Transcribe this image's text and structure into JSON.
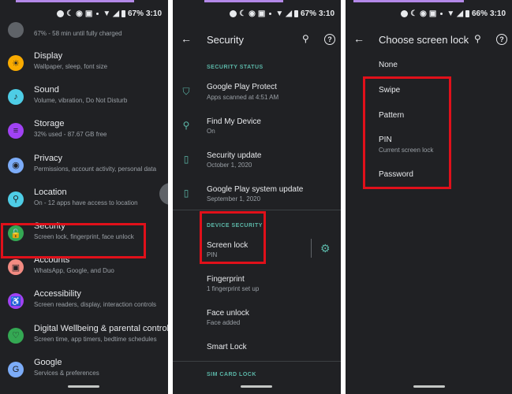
{
  "status": {
    "battery": "67%",
    "time": "3:10",
    "battery_p3": "66%",
    "network": "4G"
  },
  "settings_list": {
    "partial_top_sub": "67% - 58 min until fully charged",
    "items": [
      {
        "title": "Display",
        "subtitle": "Wallpaper, sleep, font size",
        "icon": "display-icon",
        "color": "#f9ab00"
      },
      {
        "title": "Sound",
        "subtitle": "Volume, vibration, Do Not Disturb",
        "icon": "sound-icon",
        "color": "#4ecde6"
      },
      {
        "title": "Storage",
        "subtitle": "32% used - 87.67 GB free",
        "icon": "storage-icon",
        "color": "#a142f4"
      },
      {
        "title": "Privacy",
        "subtitle": "Permissions, account activity, personal data",
        "icon": "privacy-icon",
        "color": "#7cacf8"
      },
      {
        "title": "Location",
        "subtitle": "On - 12 apps have access to location",
        "icon": "location-icon",
        "color": "#4ecde6"
      },
      {
        "title": "Security",
        "subtitle": "Screen lock, fingerprint, face unlock",
        "icon": "security-icon",
        "color": "#34a853"
      },
      {
        "title": "Accounts",
        "subtitle": "WhatsApp, Google, and Duo",
        "icon": "accounts-icon",
        "color": "#f28b82"
      },
      {
        "title": "Accessibility",
        "subtitle": "Screen readers, display, interaction controls",
        "icon": "accessibility-icon",
        "color": "#a142f4"
      },
      {
        "title": "Digital Wellbeing & parental controls",
        "subtitle": "Screen time, app timers, bedtime schedules",
        "icon": "wellbeing-icon",
        "color": "#34a853"
      },
      {
        "title": "Google",
        "subtitle": "Services & preferences",
        "icon": "google-icon",
        "color": "#7cacf8"
      }
    ]
  },
  "security_page": {
    "title": "Security",
    "status_header": "SECURITY STATUS",
    "status_items": [
      {
        "title": "Google Play Protect",
        "subtitle": "Apps scanned at 4:51 AM"
      },
      {
        "title": "Find My Device",
        "subtitle": "On"
      },
      {
        "title": "Security update",
        "subtitle": "October 1, 2020"
      },
      {
        "title": "Google Play system update",
        "subtitle": "September 1, 2020"
      }
    ],
    "device_header": "DEVICE SECURITY",
    "device_items": [
      {
        "title": "Screen lock",
        "subtitle": "PIN"
      },
      {
        "title": "Fingerprint",
        "subtitle": "1 fingerprint set up"
      },
      {
        "title": "Face unlock",
        "subtitle": "Face added"
      },
      {
        "title": "Smart Lock",
        "subtitle": ""
      }
    ],
    "sim_header": "SIM CARD LOCK"
  },
  "lock_page": {
    "title": "Choose screen lock",
    "options": [
      {
        "title": "None",
        "subtitle": ""
      },
      {
        "title": "Swipe",
        "subtitle": ""
      },
      {
        "title": "Pattern",
        "subtitle": ""
      },
      {
        "title": "PIN",
        "subtitle": "Current screen lock"
      },
      {
        "title": "Password",
        "subtitle": ""
      }
    ]
  }
}
